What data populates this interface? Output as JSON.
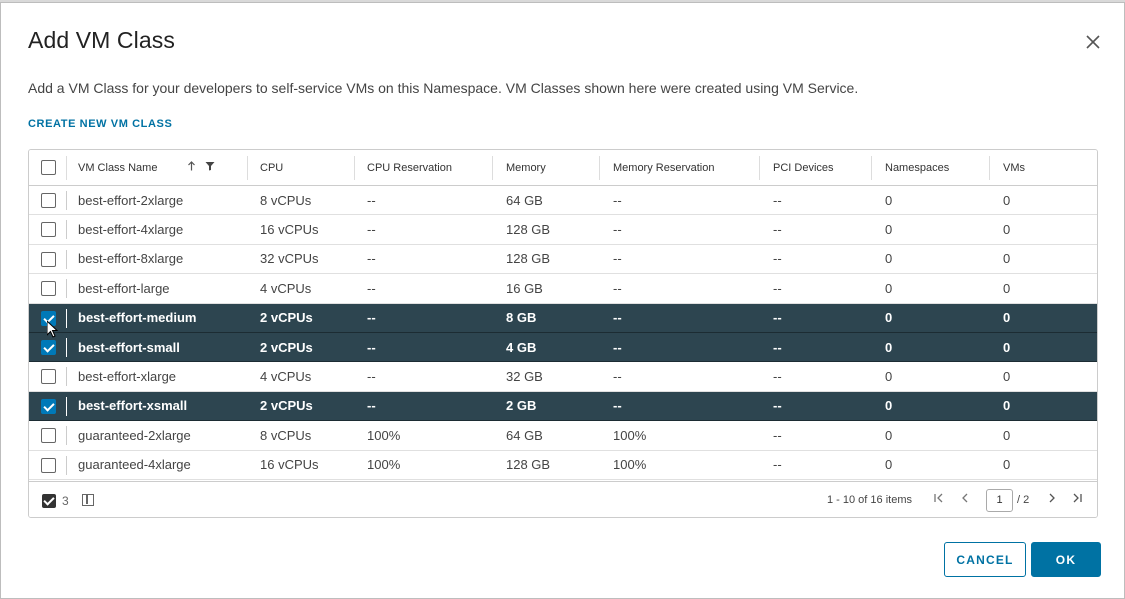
{
  "dialog": {
    "title": "Add VM Class",
    "description": "Add a VM Class for your developers to self-service VMs on this Namespace. VM Classes shown here were created using VM Service.",
    "create_link": "CREATE NEW VM CLASS"
  },
  "table": {
    "columns": [
      "VM Class Name",
      "CPU",
      "CPU Reservation",
      "Memory",
      "Memory Reservation",
      "PCI Devices",
      "Namespaces",
      "VMs"
    ],
    "sort": "ascending",
    "rows": [
      {
        "name": "best-effort-2xlarge",
        "cpu": "8 vCPUs",
        "cpu_res": "--",
        "memory": "64 GB",
        "mem_res": "--",
        "pci": "--",
        "namespaces": "0",
        "vms": "0",
        "selected": false
      },
      {
        "name": "best-effort-4xlarge",
        "cpu": "16 vCPUs",
        "cpu_res": "--",
        "memory": "128 GB",
        "mem_res": "--",
        "pci": "--",
        "namespaces": "0",
        "vms": "0",
        "selected": false
      },
      {
        "name": "best-effort-8xlarge",
        "cpu": "32 vCPUs",
        "cpu_res": "--",
        "memory": "128 GB",
        "mem_res": "--",
        "pci": "--",
        "namespaces": "0",
        "vms": "0",
        "selected": false
      },
      {
        "name": "best-effort-large",
        "cpu": "4 vCPUs",
        "cpu_res": "--",
        "memory": "16 GB",
        "mem_res": "--",
        "pci": "--",
        "namespaces": "0",
        "vms": "0",
        "selected": false
      },
      {
        "name": "best-effort-medium",
        "cpu": "2 vCPUs",
        "cpu_res": "--",
        "memory": "8 GB",
        "mem_res": "--",
        "pci": "--",
        "namespaces": "0",
        "vms": "0",
        "selected": true
      },
      {
        "name": "best-effort-small",
        "cpu": "2 vCPUs",
        "cpu_res": "--",
        "memory": "4 GB",
        "mem_res": "--",
        "pci": "--",
        "namespaces": "0",
        "vms": "0",
        "selected": true
      },
      {
        "name": "best-effort-xlarge",
        "cpu": "4 vCPUs",
        "cpu_res": "--",
        "memory": "32 GB",
        "mem_res": "--",
        "pci": "--",
        "namespaces": "0",
        "vms": "0",
        "selected": false
      },
      {
        "name": "best-effort-xsmall",
        "cpu": "2 vCPUs",
        "cpu_res": "--",
        "memory": "2 GB",
        "mem_res": "--",
        "pci": "--",
        "namespaces": "0",
        "vms": "0",
        "selected": true
      },
      {
        "name": "guaranteed-2xlarge",
        "cpu": "8 vCPUs",
        "cpu_res": "100%",
        "memory": "64 GB",
        "mem_res": "100%",
        "pci": "--",
        "namespaces": "0",
        "vms": "0",
        "selected": false
      },
      {
        "name": "guaranteed-4xlarge",
        "cpu": "16 vCPUs",
        "cpu_res": "100%",
        "memory": "128 GB",
        "mem_res": "100%",
        "pci": "--",
        "namespaces": "0",
        "vms": "0",
        "selected": false
      }
    ]
  },
  "footer": {
    "selected_count": "3",
    "items_text": "1 - 10 of 16 items",
    "page_current": "1",
    "page_total": "/ 2"
  },
  "buttons": {
    "cancel": "CANCEL",
    "ok": "OK"
  },
  "colors": {
    "accent": "#0072a3",
    "selected_row": "#2d4550",
    "checkbox_checked": "#0079b8"
  }
}
